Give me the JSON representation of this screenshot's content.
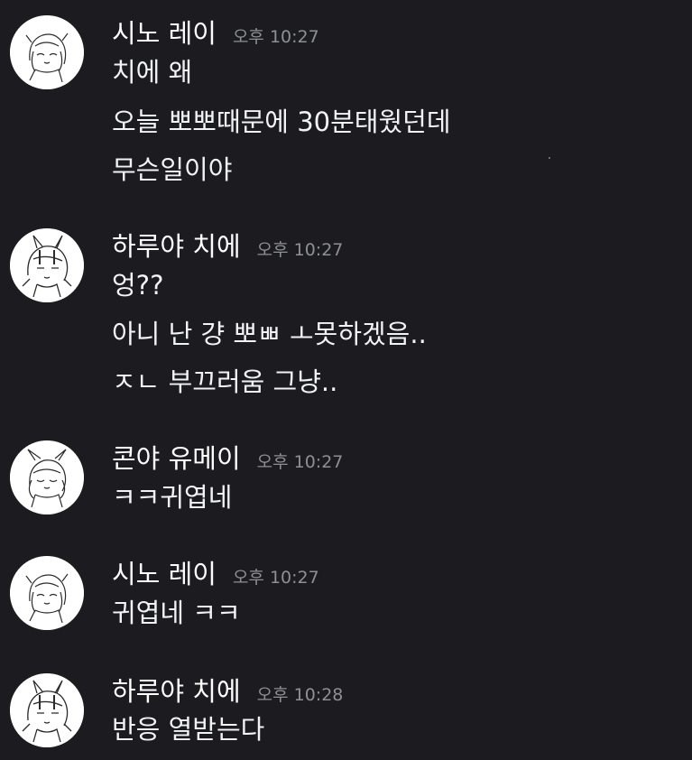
{
  "messages": [
    {
      "username": "시노 레이",
      "timestamp": "오후 10:27",
      "lines": [
        "치에 왜",
        "오늘 뽀뽀때문에 30분태웠던데",
        "무슨일이야"
      ]
    },
    {
      "username": "하루야 치에",
      "timestamp": "오후 10:27",
      "lines": [
        "엉??",
        "아니 난 걍 뽀ㅃ ㅗ못하겠음..",
        "ㅈㄴ 부끄러움 그냥.."
      ]
    },
    {
      "username": "콘야 유메이",
      "timestamp": "오후 10:27",
      "lines": [
        "ㅋㅋ귀엽네"
      ]
    },
    {
      "username": "시노 레이",
      "timestamp": "오후 10:27",
      "lines": [
        "귀엽네 ㅋㅋ"
      ]
    },
    {
      "username": "하루야 치에",
      "timestamp": "오후 10:28",
      "lines": [
        "반응 열받는다"
      ]
    }
  ],
  "colors": {
    "background": "#1b1b20",
    "text": "#f2f3f5",
    "timestamp": "#8e9097",
    "avatar_bg": "#ffffff"
  }
}
